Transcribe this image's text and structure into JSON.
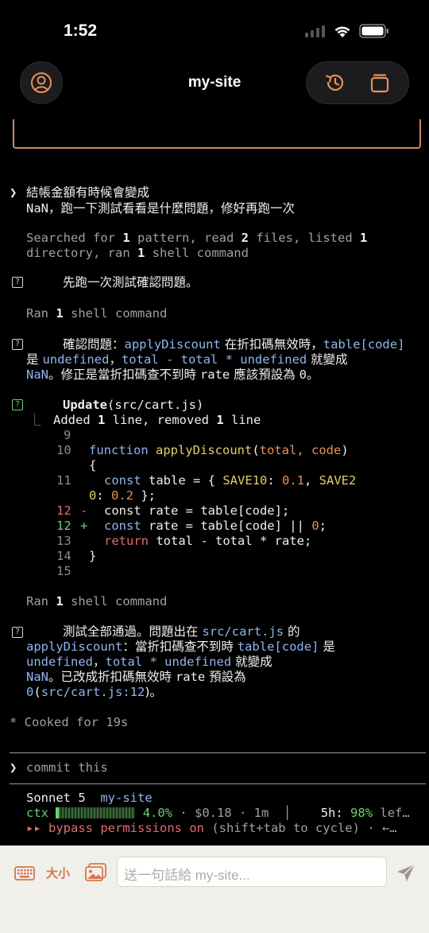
{
  "status": {
    "time": "1:52"
  },
  "header": {
    "title": "my-site"
  },
  "conversation": {
    "user_line1": "結帳金額有時候會變成",
    "user_line2": "NaN，跑一下測試看看是什麼問題，修好再跑一次",
    "search1_a": "Searched for ",
    "search1_n1": "1",
    "search1_b": " pattern, read ",
    "search1_n2": "2",
    "search1_c": " files, listed ",
    "search1_n3": "1",
    "search1_d": "directory, ran ",
    "search1_n4": "1",
    "search1_e": " shell command",
    "msg1": "先跑一次測試確認問題。",
    "ran1_a": "Ran ",
    "ran1_n": "1",
    "ran1_b": " shell command",
    "msg2_l1_a": "確認問題：",
    "msg2_l1_b": "applyDiscount",
    "msg2_l1_c": " 在折扣碼無效時，",
    "msg2_l1_d": "table[code]",
    "msg2_l2_a": "是 ",
    "msg2_l2_b": "undefined",
    "msg2_l2_c": "，",
    "msg2_l2_d": "total - total * undefined",
    "msg2_l2_e": " 就變成",
    "msg2_l3_a": "NaN",
    "msg2_l3_b": "。修正是當折扣碼查不到時 ",
    "msg2_l3_c": "rate",
    "msg2_l3_d": " 應該預設為 ",
    "msg2_l3_e": "0",
    "msg2_l3_f": "。",
    "update_label": "Update",
    "update_file": "(src/cart.js)",
    "added_a": "Added ",
    "added_n1": "1",
    "added_b": " line, removed ",
    "added_n2": "1",
    "added_c": " line",
    "ran2_a": "Ran ",
    "ran2_n": "1",
    "ran2_b": " shell command",
    "msg3_l1_a": "測試全部通過。問題出在 ",
    "msg3_l1_b": "src/cart.js",
    "msg3_l1_c": " 的",
    "msg3_l2_a": "applyDiscount",
    "msg3_l2_b": "：當折扣碼查不到時 ",
    "msg3_l2_c": "table[code]",
    "msg3_l2_d": " 是",
    "msg3_l3_a": "undefined",
    "msg3_l3_b": "，",
    "msg3_l3_c": "total * undefined",
    "msg3_l3_d": " 就變成",
    "msg3_l4_a": "NaN",
    "msg3_l4_b": "。已改成折扣碼無效時 ",
    "msg3_l4_c": "rate",
    "msg3_l4_d": " 預設為",
    "msg3_l5_a": "0",
    "msg3_l5_b": "(",
    "msg3_l5_c": "src/cart.js:12",
    "msg3_l5_d": ")。",
    "cooked": "* Cooked for 19s"
  },
  "diff": {
    "l9": "9",
    "l10": "10",
    "l10_kw": "function",
    "l10_fn": "applyDiscount",
    "l10_p": "(",
    "l10_args": "total, code",
    "l10_q": ")",
    "l10b": "{",
    "l11": "11",
    "l11_kw": "const",
    "l11_a": " table = { ",
    "l11_k1": "SAVE10",
    "l11_c": ": ",
    "l11_v1": "0.1",
    "l11_d": ", ",
    "l11_k2": "SAVE2",
    "l11b_k": "0",
    "l11b_a": ": ",
    "l11b_v": "0.2",
    "l11b_b": " };",
    "l12r": "12",
    "l12r_sign": "-",
    "l12r_text": "const rate = table[code];",
    "l12a": "12",
    "l12a_sign": "+",
    "l12a_kw": "const",
    "l12a_a": " rate = table[code] || ",
    "l12a_v": "0",
    "l12a_b": ";",
    "l13": "13",
    "l13_kw": "return",
    "l13_a": " total - total * rate;",
    "l14": "14",
    "l14_a": "}",
    "l15": "15"
  },
  "prompt": {
    "caret": "❯",
    "text": "commit this"
  },
  "footer": {
    "model": "Sonnet 5",
    "project": "my-site",
    "ctx_label": "ctx",
    "ctx_pct": "4.0%",
    "ctx_pct_value": 0.04,
    "cost": " · $0.18 · 1m",
    "sep": "│",
    "usage_label": "5h:",
    "usage_pct": "98%",
    "usage_more": " lef…",
    "bypass_arrows": "▸▸",
    "bypass": "bypass permissions on",
    "bypass_hint": " (shift+tab to cycle) · ←…"
  },
  "composer": {
    "size_label": "大小",
    "placeholder": "送一句話給 my-site..."
  },
  "colors": {
    "accent": "#c98a6a",
    "blue": "#8fb5ee",
    "orange": "#e8905c",
    "green": "#6fcf6f",
    "red": "#e26c6c"
  }
}
